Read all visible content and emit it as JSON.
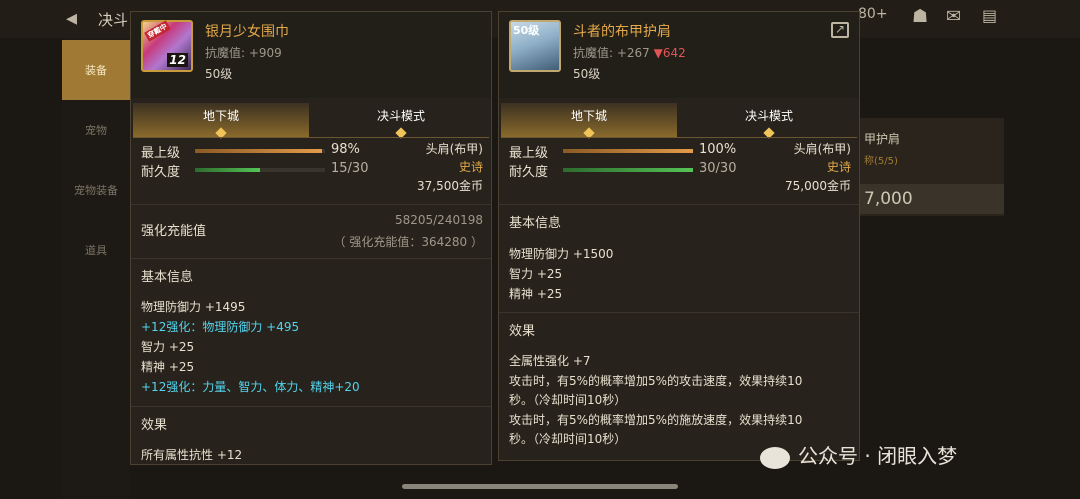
{
  "background": {
    "title": "决斗",
    "top_right_value": "80+",
    "sidebar_tabs": [
      "装备",
      "宠物",
      "宠物装备",
      "道具"
    ],
    "right_card": {
      "title": "甲护肩",
      "subtitle": "称(5/5)",
      "price": "7,000"
    }
  },
  "left_item": {
    "name": "银月少女围巾",
    "resist": "抗魔值: +909",
    "level": "50级",
    "icon_badge_tag": "穿戴中",
    "icon_badge_level": "12",
    "tabs": [
      "地下城",
      "决斗模式"
    ],
    "stats": {
      "top_label": "最上级",
      "top_value": "98%",
      "top_fraction": 0.98,
      "dur_label": "耐久度",
      "dur_value": "15/30",
      "dur_fraction": 0.5
    },
    "slot": "头肩(布甲)",
    "rarity": "史诗",
    "price": "37,500金币",
    "charge": {
      "label": "强化充能值",
      "value": "58205/240198",
      "sub": "（ 强化充能值：364280 ）"
    },
    "basic_title": "基本信息",
    "basic_lines": [
      {
        "text": "物理防御力 +1495",
        "color": "normal"
      },
      {
        "text": "+12强化：物理防御力 +495",
        "color": "cyan"
      },
      {
        "text": "智力 +25",
        "color": "normal"
      },
      {
        "text": "精神 +25",
        "color": "normal"
      },
      {
        "text": "+12强化：力量、智力、体力、精神+20",
        "color": "cyan"
      }
    ],
    "effect_title": "效果",
    "effect_lines": [
      "所有属性抗性 +12"
    ]
  },
  "right_item": {
    "name": "斗者的布甲护肩",
    "resist_prefix": "抗魔值: +267",
    "resist_down": "▼642",
    "level": "50级",
    "icon_badge_level": "50级",
    "tabs": [
      "地下城",
      "决斗模式"
    ],
    "stats": {
      "top_label": "最上级",
      "top_value": "100%",
      "top_fraction": 1.0,
      "dur_label": "耐久度",
      "dur_value": "30/30",
      "dur_fraction": 1.0
    },
    "slot": "头肩(布甲)",
    "rarity": "史诗",
    "price": "75,000金币",
    "basic_title": "基本信息",
    "basic_lines": [
      "物理防御力 +1500",
      "智力 +25",
      "精神 +25"
    ],
    "effect_title": "效果",
    "effect_lines": [
      "全属性强化 +7",
      "攻击时，有5%的概率增加5%的攻击速度，效果持续10",
      "秒。（冷却时间10秒）",
      "攻击时，有5%的概率增加5%的施放速度，效果持续10",
      "秒。（冷却时间10秒）"
    ]
  },
  "watermark": "公众号 · 闭眼入梦"
}
